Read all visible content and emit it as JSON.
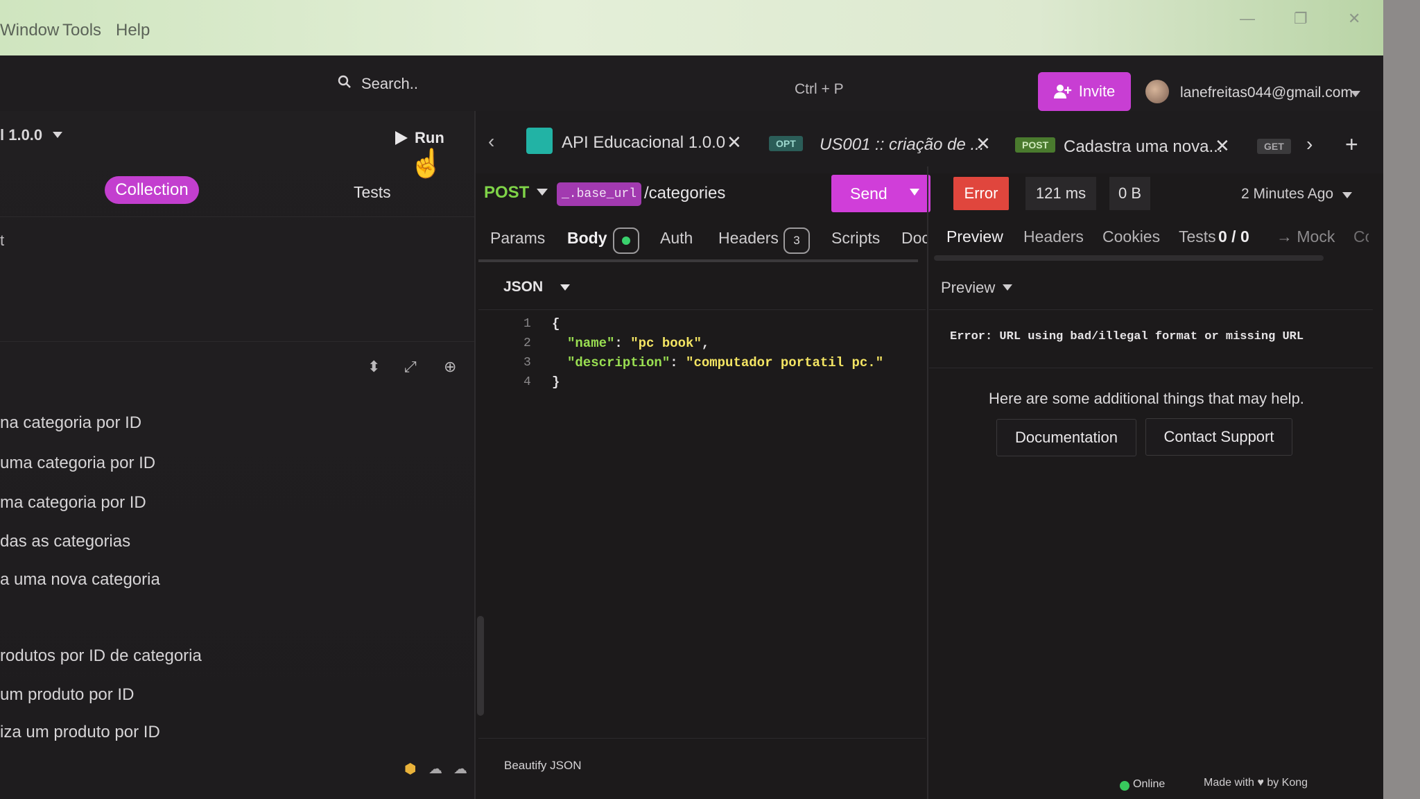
{
  "menu": {
    "window": "Window",
    "tools": "Tools",
    "help": "Help"
  },
  "header": {
    "search_placeholder": "Search..",
    "shortcut": "Ctrl + P",
    "invite_label": "Invite",
    "user_email": "lanefreitas044@gmail.com"
  },
  "sidebar": {
    "version": "l 1.0.0",
    "run_label": "Run",
    "tabs": {
      "collection": "Collection",
      "tests": "Tests"
    },
    "filter_text": "t",
    "items": [
      "na categoria por ID",
      "uma categoria por ID",
      "ma categoria por ID",
      "das as categorias",
      "a uma nova categoria",
      "rodutos por ID de categoria",
      "um produto por ID",
      "iza um produto por ID"
    ]
  },
  "tabs": [
    {
      "label": "API Educacional 1.0.0",
      "type": "document"
    },
    {
      "badge": "OPT",
      "label": "US001 :: criação de ..."
    },
    {
      "badge": "POST",
      "label": "Cadastra uma nova..."
    },
    {
      "badge": "GET",
      "label": ""
    }
  ],
  "request": {
    "method": "POST",
    "base_url_tag": "_.base_url",
    "path": "/categories",
    "send_label": "Send",
    "tabs": [
      "Params",
      "Body",
      "Auth",
      "Headers",
      "Scripts",
      "Docs"
    ],
    "headers_count": "3",
    "body_mode": "JSON",
    "code_lines": [
      "1",
      "2",
      "3",
      "4"
    ],
    "body": {
      "name_key": "\"name\"",
      "name_val": "\"pc book\"",
      "desc_key": "\"description\"",
      "desc_val": "\"computador portatil pc.\""
    },
    "beautify": "Beautify JSON"
  },
  "response": {
    "status": "Error",
    "time": "121 ms",
    "size": "0 B",
    "ago": "2 Minutes Ago",
    "tabs": [
      "Preview",
      "Headers",
      "Cookies",
      "Tests",
      "0 / 0",
      "→ Mock",
      "Co"
    ],
    "preview_mode": "Preview",
    "error_message": "Error: URL using bad/illegal format or missing URL",
    "help_text": "Here are some additional things that may help.",
    "doc_button": "Documentation",
    "support_button": "Contact Support"
  },
  "footer": {
    "online": "Online",
    "made_with": "Made with ♥ by Kong"
  },
  "colors": {
    "accent": "#c83ed3",
    "error": "#e0463d",
    "post_green": "#7fd348",
    "online": "#38c85d"
  }
}
